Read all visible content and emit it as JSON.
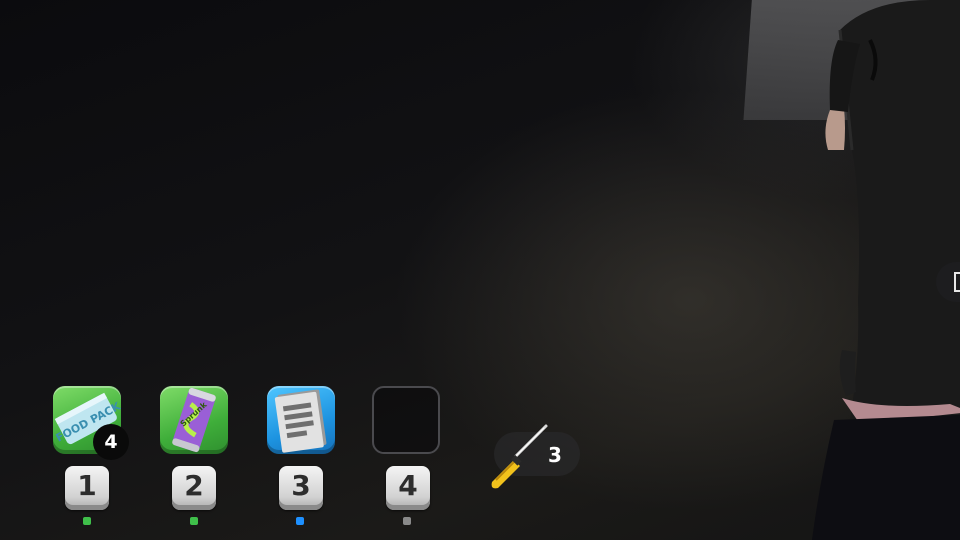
{
  "hotbar": {
    "slots": [
      {
        "key": "1",
        "item_icon": "food-pack-icon",
        "item_text": "FOOD PACK",
        "stack_count": "4",
        "indicator_color": "#3fbf4a"
      },
      {
        "key": "2",
        "item_icon": "soda-can-icon",
        "item_text": "Sprunk",
        "indicator_color": "#3fbf4a"
      },
      {
        "key": "3",
        "item_icon": "document-icon",
        "indicator_color": "#1e90ff"
      },
      {
        "key": "4",
        "item_icon": "empty-slot",
        "indicator_color": "#8a8a8a"
      }
    ]
  },
  "equipped_tool": {
    "icon": "screwdriver-icon",
    "count": "3"
  },
  "edge_prompt": {
    "icon": "interaction-box-icon"
  }
}
